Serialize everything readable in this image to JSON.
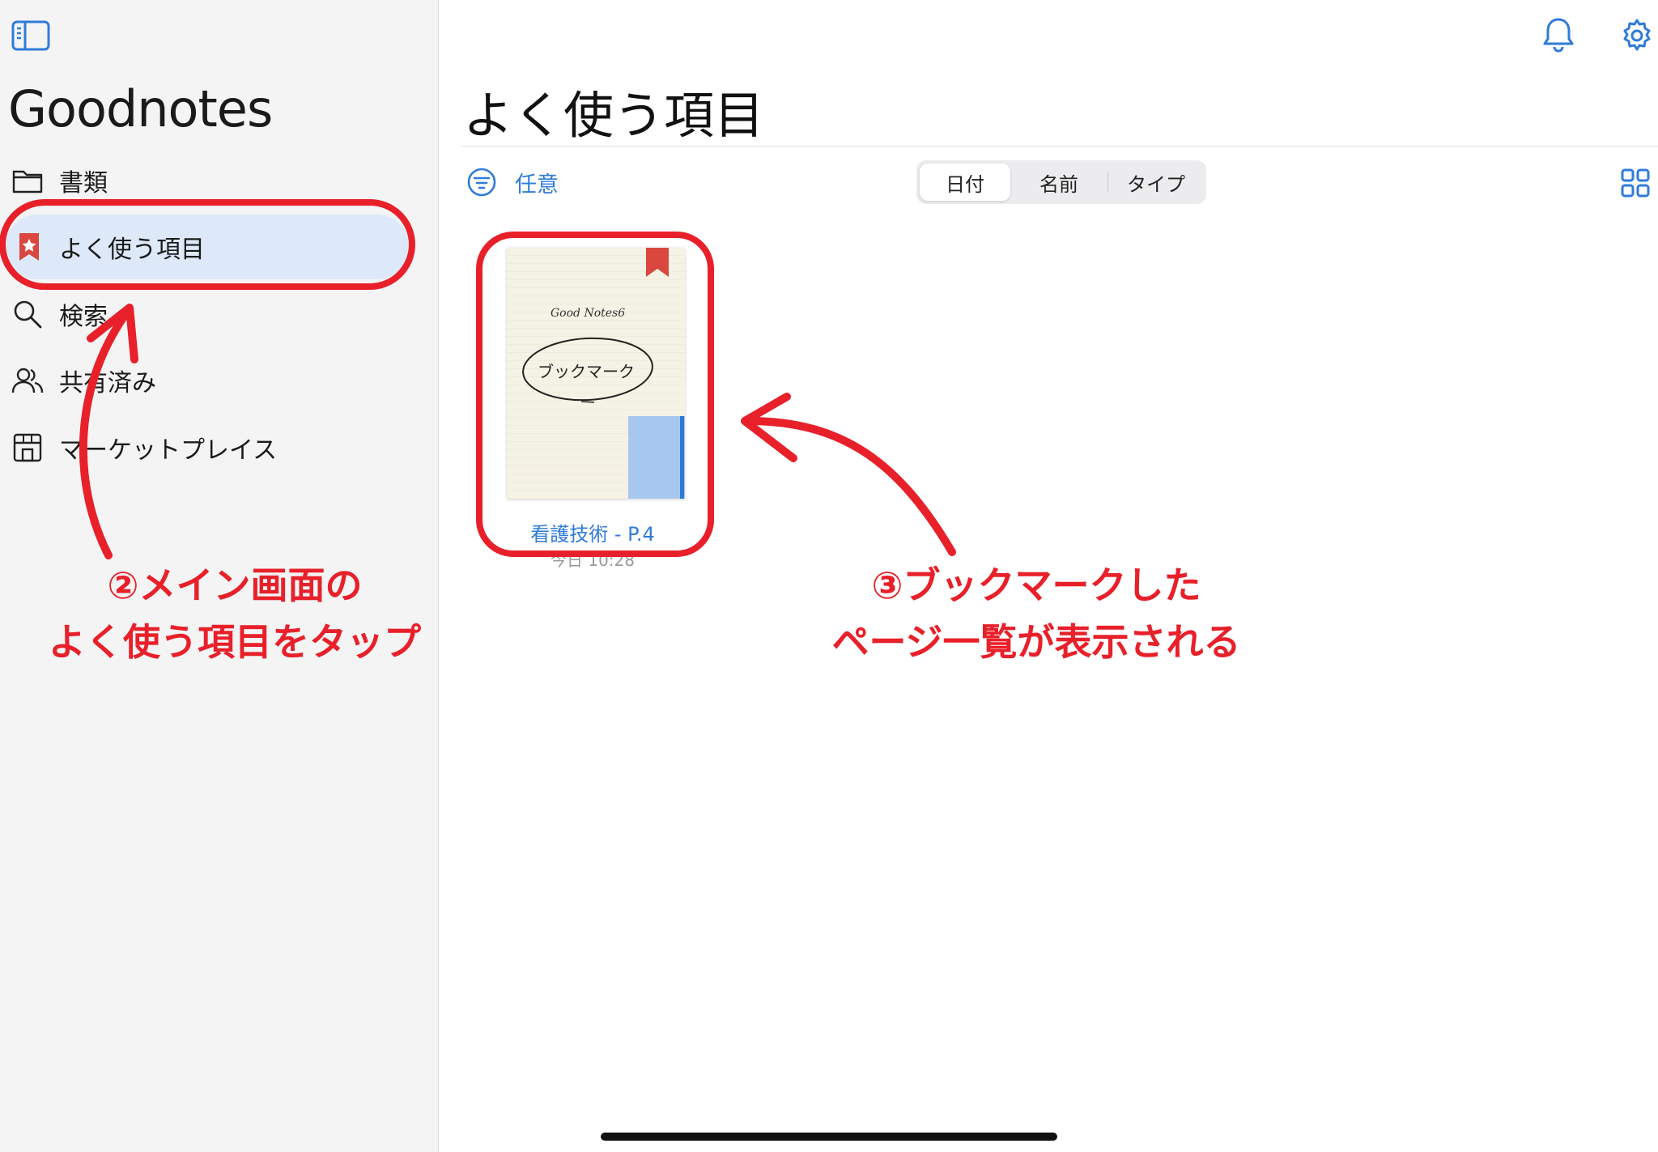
{
  "app": {
    "title": "Goodnotes"
  },
  "sidebar": {
    "items": [
      {
        "id": "documents",
        "label": "書類",
        "icon": "folder-icon"
      },
      {
        "id": "favorites",
        "label": "よく使う項目",
        "icon": "bookmark-star-icon",
        "selected": true
      },
      {
        "id": "search",
        "label": "検索",
        "icon": "search-icon"
      },
      {
        "id": "shared",
        "label": "共有済み",
        "icon": "people-icon"
      },
      {
        "id": "marketplace",
        "label": "マーケットプレイス",
        "icon": "storefront-icon"
      }
    ]
  },
  "main": {
    "title": "よく使う項目",
    "filter_label": "任意",
    "sort_options": [
      "日付",
      "名前",
      "タイプ"
    ],
    "selected_sort": "日付",
    "documents": [
      {
        "name": "看護技術 - P.4",
        "date": "今日 10:28",
        "thumbnail_header": "Good Notes6",
        "thumbnail_text": "ブックマーク"
      }
    ]
  },
  "annotations": {
    "step2_line1": "②メイン画面の",
    "step2_line2": "よく使う項目をタップ",
    "step3_line1": "③ブックマークした",
    "step3_line2": "ページ一覧が表示される"
  },
  "colors": {
    "accent": "#2f7bd9",
    "annotation_red": "#e8202a",
    "selected_bg": "#dde9f8",
    "bookmark_red": "#d9473f"
  }
}
